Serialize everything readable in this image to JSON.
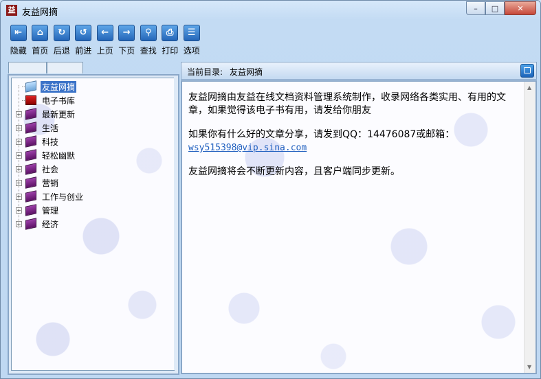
{
  "window": {
    "title": "友益网摘",
    "app_icon_glyph": "益",
    "controls": {
      "minimize": "–",
      "maximize": "□",
      "close": "✕"
    }
  },
  "toolbar": [
    {
      "label": "隐藏",
      "icon": "hide-icon",
      "glyph": "⇤"
    },
    {
      "label": "首页",
      "icon": "home-icon",
      "glyph": "⌂"
    },
    {
      "label": "后退",
      "icon": "back-circle-icon",
      "glyph": "↻"
    },
    {
      "label": "前进",
      "icon": "forward-circle-icon",
      "glyph": "↺"
    },
    {
      "label": "上页",
      "icon": "arrow-left-icon",
      "glyph": "←"
    },
    {
      "label": "下页",
      "icon": "arrow-right-icon",
      "glyph": "→"
    },
    {
      "label": "查找",
      "icon": "search-icon",
      "glyph": "⚲"
    },
    {
      "label": "打印",
      "icon": "print-icon",
      "glyph": "⎙"
    },
    {
      "label": "选项",
      "icon": "options-icon",
      "glyph": "☰"
    }
  ],
  "tree": [
    {
      "label": "友益网摘",
      "selected": true,
      "expandable": false,
      "icon": "book-open-icon"
    },
    {
      "label": "电子书库",
      "selected": false,
      "expandable": false,
      "icon": "library-icon"
    },
    {
      "label": "最新更新",
      "selected": false,
      "expandable": true,
      "icon": "book-icon"
    },
    {
      "label": "生活",
      "selected": false,
      "expandable": true,
      "icon": "book-icon"
    },
    {
      "label": "科技",
      "selected": false,
      "expandable": true,
      "icon": "book-icon"
    },
    {
      "label": "轻松幽默",
      "selected": false,
      "expandable": true,
      "icon": "book-icon"
    },
    {
      "label": "社会",
      "selected": false,
      "expandable": true,
      "icon": "book-icon"
    },
    {
      "label": "营销",
      "selected": false,
      "expandable": true,
      "icon": "book-icon"
    },
    {
      "label": "工作与创业",
      "selected": false,
      "expandable": true,
      "icon": "book-icon"
    },
    {
      "label": "管理",
      "selected": false,
      "expandable": true,
      "icon": "book-icon"
    },
    {
      "label": "经济",
      "selected": false,
      "expandable": true,
      "icon": "book-icon"
    }
  ],
  "content_header": {
    "dir_label": "当前目录:",
    "dir_value": "友益网摘"
  },
  "article": {
    "para1": "友益网摘由友益在线文档资料管理系统制作，收录网络各类实用、有用的文章，如果觉得该电子书有用，请发给你朋友",
    "para2_prefix": "如果你有什么好的文章分享，请发到QQ：14476087或邮箱：",
    "email": "wsy515398@vip.sina.com",
    "para3": "友益网摘将会不断更新内容，且客户端同步更新。"
  }
}
